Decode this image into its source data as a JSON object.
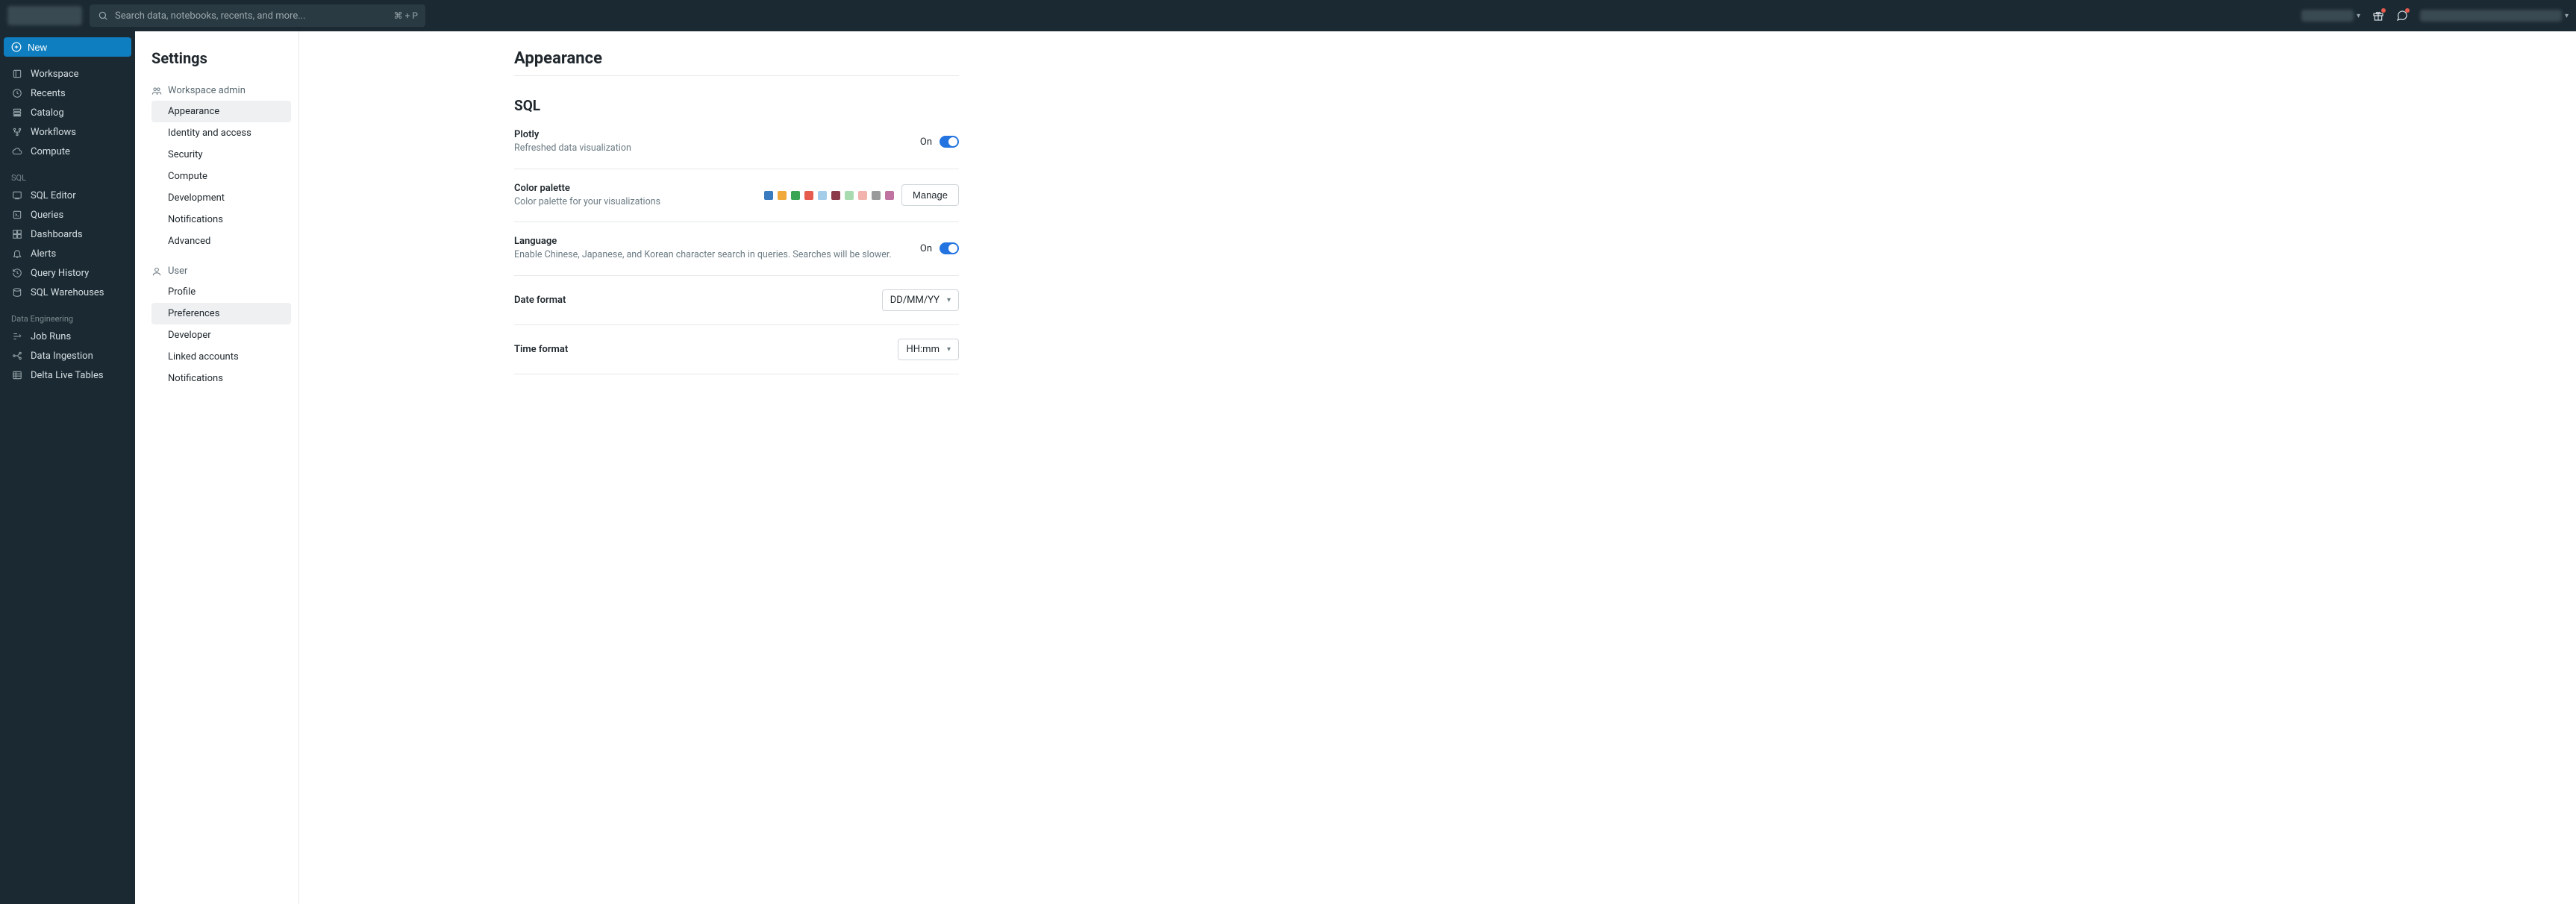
{
  "topbar": {
    "search_placeholder": "Search data, notebooks, recents, and more...",
    "search_shortcut": "⌘ + P"
  },
  "sidebar": {
    "new_label": "New",
    "primary": [
      {
        "label": "Workspace",
        "icon": "folder"
      },
      {
        "label": "Recents",
        "icon": "clock"
      },
      {
        "label": "Catalog",
        "icon": "catalog"
      },
      {
        "label": "Workflows",
        "icon": "workflow"
      },
      {
        "label": "Compute",
        "icon": "cloud"
      }
    ],
    "sql_heading": "SQL",
    "sql": [
      {
        "label": "SQL Editor",
        "icon": "sql"
      },
      {
        "label": "Queries",
        "icon": "query"
      },
      {
        "label": "Dashboards",
        "icon": "dashboard"
      },
      {
        "label": "Alerts",
        "icon": "bell"
      },
      {
        "label": "Query History",
        "icon": "history"
      },
      {
        "label": "SQL Warehouses",
        "icon": "warehouse"
      }
    ],
    "de_heading": "Data Engineering",
    "de": [
      {
        "label": "Job Runs",
        "icon": "jobruns"
      },
      {
        "label": "Data Ingestion",
        "icon": "ingest"
      },
      {
        "label": "Delta Live Tables",
        "icon": "dlt"
      }
    ]
  },
  "settings_nav": {
    "title": "Settings",
    "admin_heading": "Workspace admin",
    "admin": [
      "Appearance",
      "Identity and access",
      "Security",
      "Compute",
      "Development",
      "Notifications",
      "Advanced"
    ],
    "user_heading": "User",
    "user": [
      "Profile",
      "Preferences",
      "Developer",
      "Linked accounts",
      "Notifications"
    ],
    "active_admin": "Appearance",
    "active_user": "Preferences"
  },
  "page": {
    "title": "Appearance",
    "section_sql": "SQL",
    "plotly": {
      "label": "Plotly",
      "desc": "Refreshed data visualization",
      "state_text": "On"
    },
    "palette": {
      "label": "Color palette",
      "desc": "Color palette for your visualizations",
      "colors": [
        "#3a7bbf",
        "#f0a93a",
        "#3aa655",
        "#e65b4d",
        "#a3cde8",
        "#8c3a4a",
        "#a8dcb0",
        "#f2b3ad",
        "#9a9a9a",
        "#c072a0"
      ],
      "button": "Manage"
    },
    "language": {
      "label": "Language",
      "desc": "Enable Chinese, Japanese, and Korean character search in queries. Searches will be slower.",
      "state_text": "On"
    },
    "date_format": {
      "label": "Date format",
      "value": "DD/MM/YY"
    },
    "time_format": {
      "label": "Time format",
      "value": "HH:mm"
    }
  }
}
